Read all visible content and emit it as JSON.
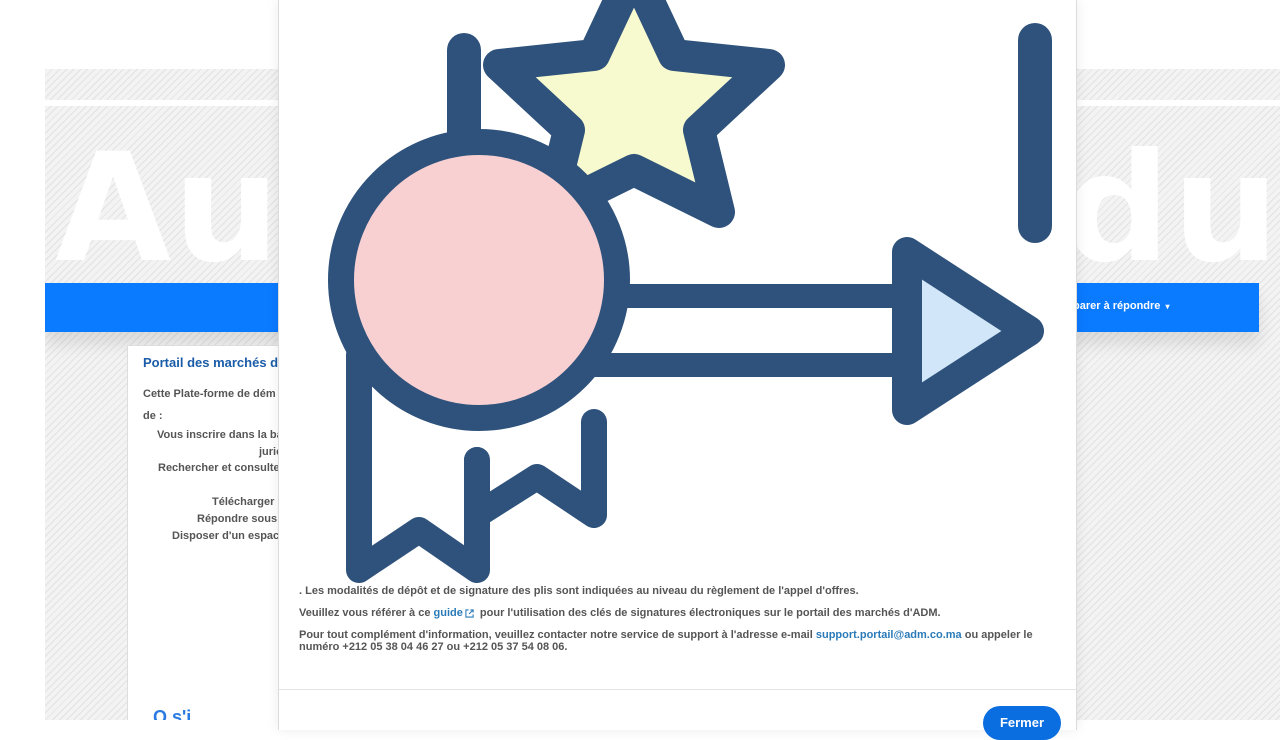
{
  "background": {
    "hero_text_left": "Au",
    "hero_text_right": "du",
    "nav_item_prepare": "parer à répondre",
    "panel_title": "Portail des marchés d'A",
    "panel_lines": [
      "Cette Plate-forme de dém",
      "de :",
      "Vous inscrire dans la bas",
      "juric",
      "Rechercher et consulter",
      "Télécharger l",
      "Répondre sous f",
      "Disposer d'un espace"
    ],
    "panel_link": "Q s'i"
  },
  "modal": {
    "illustration_icon": "award-ribbon-star-arrow-icon",
    "colors": {
      "stroke": "#2e527b",
      "circle_fill": "#f8d0d2",
      "star_fill": "#f7f9cf",
      "arrow_fill": "#d1e6f8"
    },
    "paragraph_1": ". Les modalités de dépôt et de signature des plis sont indiquées au niveau du règlement de l'appel d'offres.",
    "paragraph_2_before": "Veuillez vous référer à ce ",
    "paragraph_2_link": "guide",
    "paragraph_2_after": " pour l'utilisation des clés de signatures électroniques sur le portail des marchés d'ADM.",
    "paragraph_3_before": "Pour tout complément d'information, veuillez contacter notre service de support à l'adresse e-mail ",
    "paragraph_3_email": "support.portail@adm.co.ma",
    "paragraph_3_after": " ou appeler le numéro +212 05 38 04 46 27 ou +212 05 37 54 08 06.",
    "button_label": "Fermer"
  }
}
